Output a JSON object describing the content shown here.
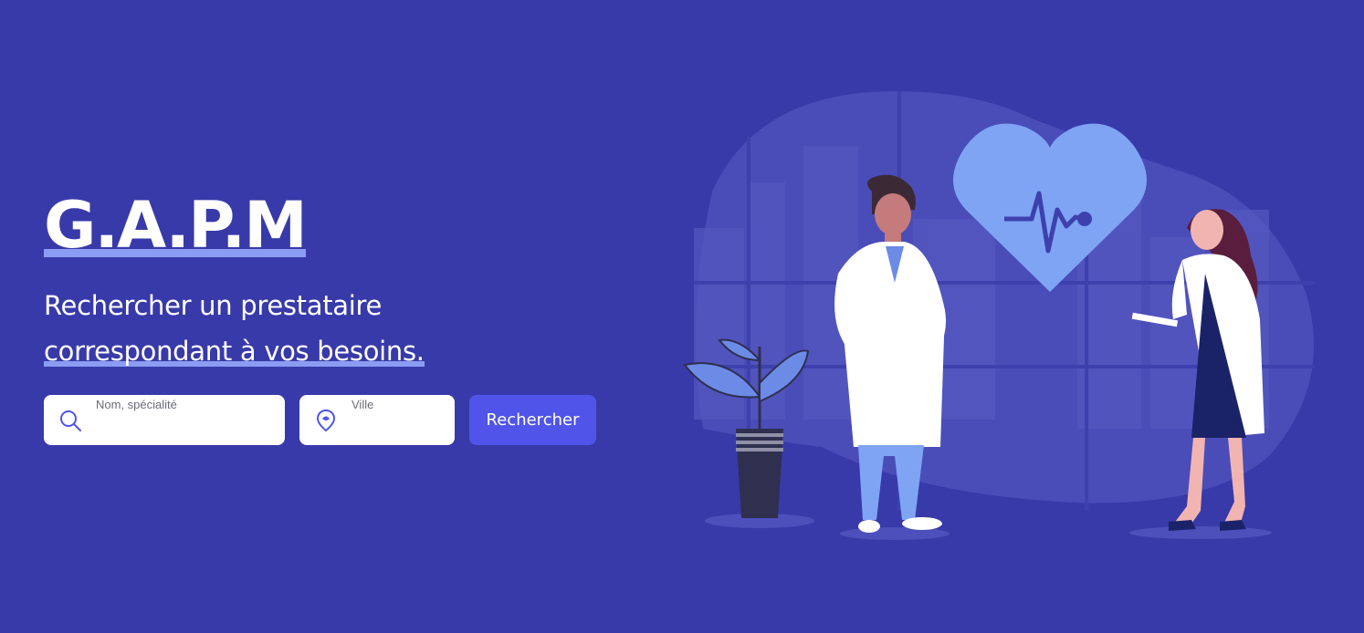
{
  "hero": {
    "brand": "G.A.P.M",
    "tagline_line1": "Rechercher un prestataire",
    "tagline_line2": "correspondant à vos besoins."
  },
  "search": {
    "name_label": "Nom, spécialité",
    "name_value": "",
    "city_label": "Ville",
    "city_value": "",
    "button_label": "Rechercher"
  },
  "colors": {
    "background": "#383aa9",
    "accent_underline": "#8a9df2",
    "button": "#5054e8",
    "heart": "#7fa4f4"
  },
  "icons": {
    "name_field_icon": "search-icon",
    "city_field_icon": "location-pin-icon"
  }
}
